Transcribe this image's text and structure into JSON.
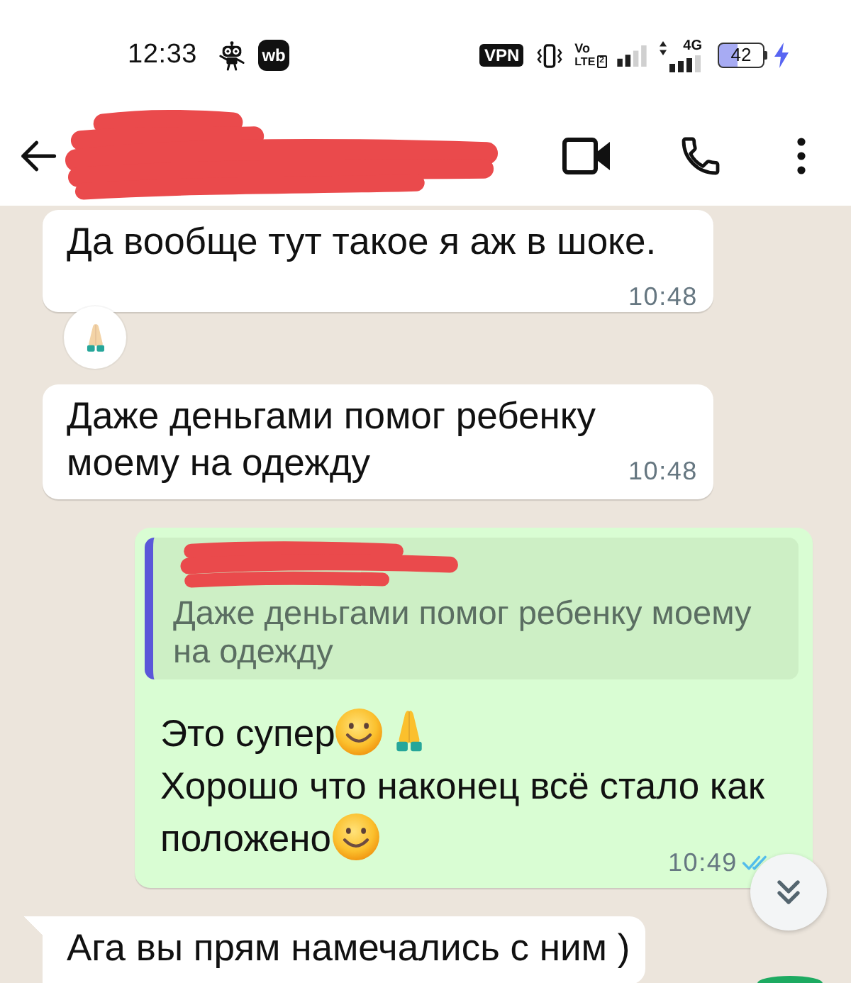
{
  "status_bar": {
    "time": "12:33",
    "app_badge": "wb",
    "vpn": "VPN",
    "volte": {
      "top": "Vo",
      "bottom": "LTE",
      "sim": "2"
    },
    "network": "4G",
    "battery": "42"
  },
  "messages": [
    {
      "kind": "incoming",
      "tail": false,
      "paragraphs": [
        [
          {
            "kind": "text",
            "text": "Да вообще тут такое я аж в шоке."
          }
        ]
      ],
      "time": "10:48",
      "reactions": [
        {
          "kind": "pray"
        }
      ]
    },
    {
      "kind": "incoming",
      "tail": false,
      "paragraphs": [
        [
          {
            "kind": "text",
            "text": "Даже деньгами помог ребенку моему на одежду"
          }
        ]
      ],
      "time": "10:48"
    },
    {
      "kind": "outgoing",
      "tail": false,
      "quote": {
        "text": "Даже деньгами помог ребенку моему на одежду"
      },
      "paragraphs": [
        [
          {
            "kind": "text",
            "text": "Это супер"
          },
          {
            "kind": "smile"
          },
          {
            "kind": "pray"
          }
        ],
        [
          {
            "kind": "text",
            "text": "Хорошо что наконец всё стало как"
          }
        ],
        [
          {
            "kind": "text",
            "text": "положено"
          },
          {
            "kind": "smile"
          }
        ]
      ],
      "time": "10:49",
      "read": true
    },
    {
      "kind": "incoming",
      "tail": true,
      "paragraphs": [
        [
          {
            "kind": "text",
            "text": "Ага вы прям намечались с ним )"
          }
        ]
      ]
    }
  ]
}
